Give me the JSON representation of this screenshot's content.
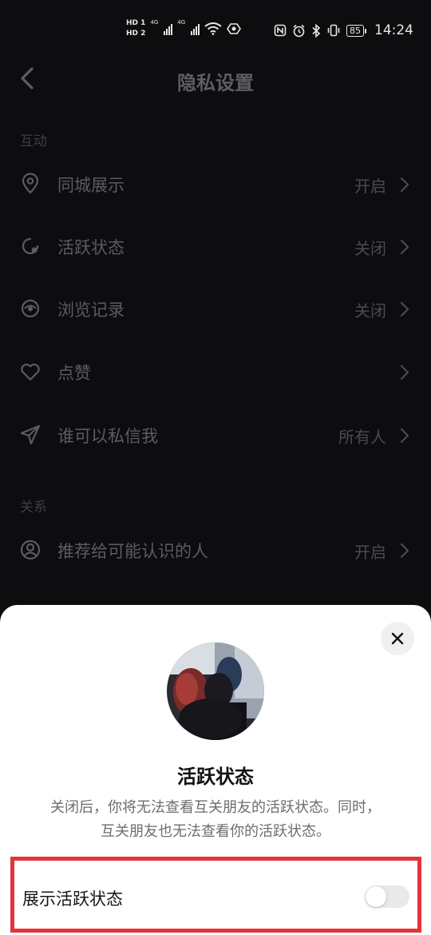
{
  "status_bar": {
    "hd1": "HD 1",
    "hd2": "HD 2",
    "net1": "4G",
    "net2": "4G",
    "battery": "85",
    "time": "14:24"
  },
  "header": {
    "title": "隐私设置"
  },
  "sections": {
    "interaction_label": "互动",
    "relation_label": "关系"
  },
  "rows": [
    {
      "label": "同城展示",
      "value": "开启",
      "icon": "location-pin-icon"
    },
    {
      "label": "活跃状态",
      "value": "关闭",
      "icon": "activity-status-icon"
    },
    {
      "label": "浏览记录",
      "value": "关闭",
      "icon": "eye-icon"
    },
    {
      "label": "点赞",
      "value": "",
      "icon": "heart-icon"
    },
    {
      "label": "谁可以私信我",
      "value": "所有人",
      "icon": "paper-plane-icon"
    },
    {
      "label": "推荐给可能认识的人",
      "value": "开启",
      "icon": "user-circle-icon"
    }
  ],
  "sheet": {
    "title": "活跃状态",
    "description_line1": "关闭后，你将无法查看互关朋友的活跃状态。同时，",
    "description_line2": "互关朋友也无法查看你的活跃状态。",
    "toggle_label": "展示活跃状态",
    "toggle_on": false
  },
  "colors": {
    "background": "#0d0d10",
    "sheet": "#ffffff",
    "highlight_border": "#e5333b"
  }
}
